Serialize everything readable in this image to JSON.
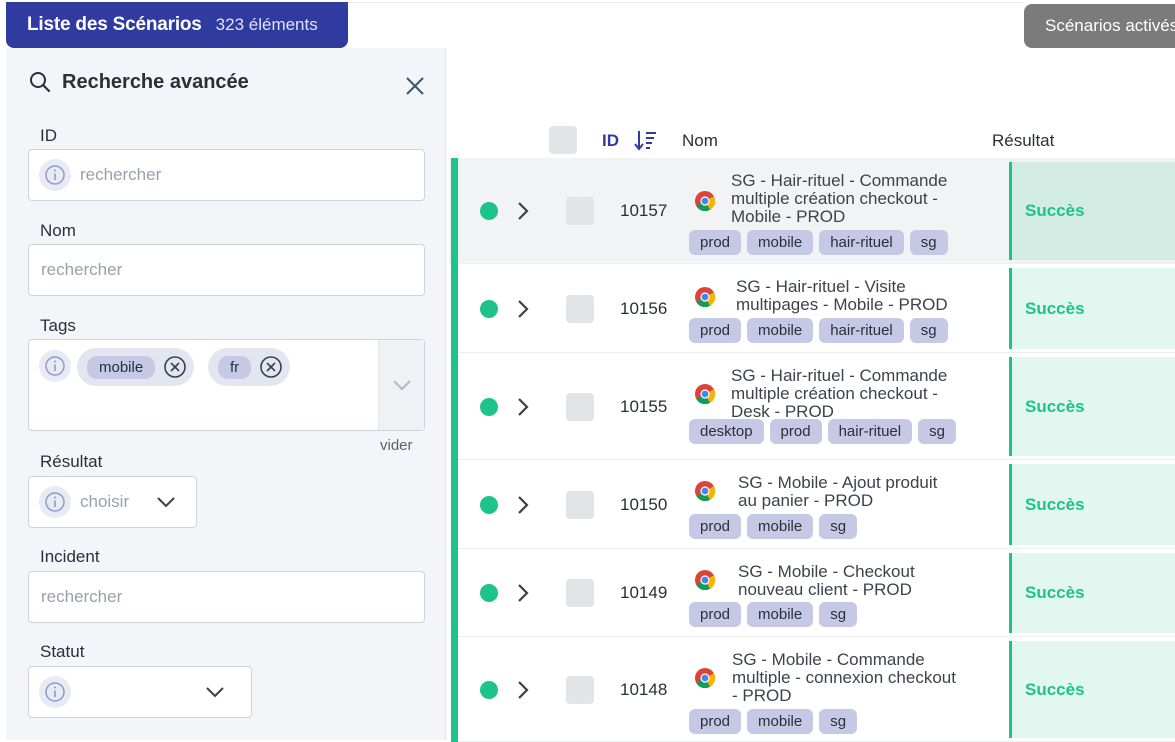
{
  "header": {
    "title": "Liste des Scénarios",
    "count": "323 éléments",
    "active_button": "Scénarios activés"
  },
  "sidebar": {
    "heading": "Recherche avancée",
    "id_label": "ID",
    "id_placeholder": "rechercher",
    "nom_label": "Nom",
    "nom_placeholder": "rechercher",
    "tags_label": "Tags",
    "tags": [
      "mobile",
      "fr"
    ],
    "tags_clear": "vider",
    "resultat_label": "Résultat",
    "resultat_placeholder": "choisir",
    "incident_label": "Incident",
    "incident_placeholder": "rechercher",
    "statut_label": "Statut"
  },
  "table": {
    "columns": {
      "id": "ID",
      "nom": "Nom",
      "resultat": "Résultat"
    },
    "rows": [
      {
        "id": "10157",
        "name_lines": [
          "SG - Hair-rituel - Commande",
          "multiple création checkout -",
          "Mobile - PROD"
        ],
        "tags": [
          "prod",
          "mobile",
          "hair-rituel",
          "sg"
        ],
        "result": "Succès"
      },
      {
        "id": "10156",
        "name_lines": [
          "SG - Hair-rituel - Visite",
          "multipages - Mobile - PROD"
        ],
        "tags": [
          "prod",
          "mobile",
          "hair-rituel",
          "sg"
        ],
        "result": "Succès"
      },
      {
        "id": "10155",
        "name_lines": [
          "SG - Hair-rituel - Commande",
          "multiple création checkout -",
          "Desk - PROD"
        ],
        "tags": [
          "desktop",
          "prod",
          "hair-rituel",
          "sg"
        ],
        "result": "Succès"
      },
      {
        "id": "10150",
        "name_lines": [
          "SG - Mobile - Ajout produit",
          "au panier - PROD"
        ],
        "tags": [
          "prod",
          "mobile",
          "sg"
        ],
        "result": "Succès"
      },
      {
        "id": "10149",
        "name_lines": [
          "SG - Mobile - Checkout",
          "nouveau client - PROD"
        ],
        "tags": [
          "prod",
          "mobile",
          "sg"
        ],
        "result": "Succès"
      },
      {
        "id": "10148",
        "name_lines": [
          "SG - Mobile - Commande",
          "multiple - connexion checkout",
          "- PROD"
        ],
        "tags": [
          "prod",
          "mobile",
          "sg"
        ],
        "result": "Succès"
      }
    ]
  }
}
